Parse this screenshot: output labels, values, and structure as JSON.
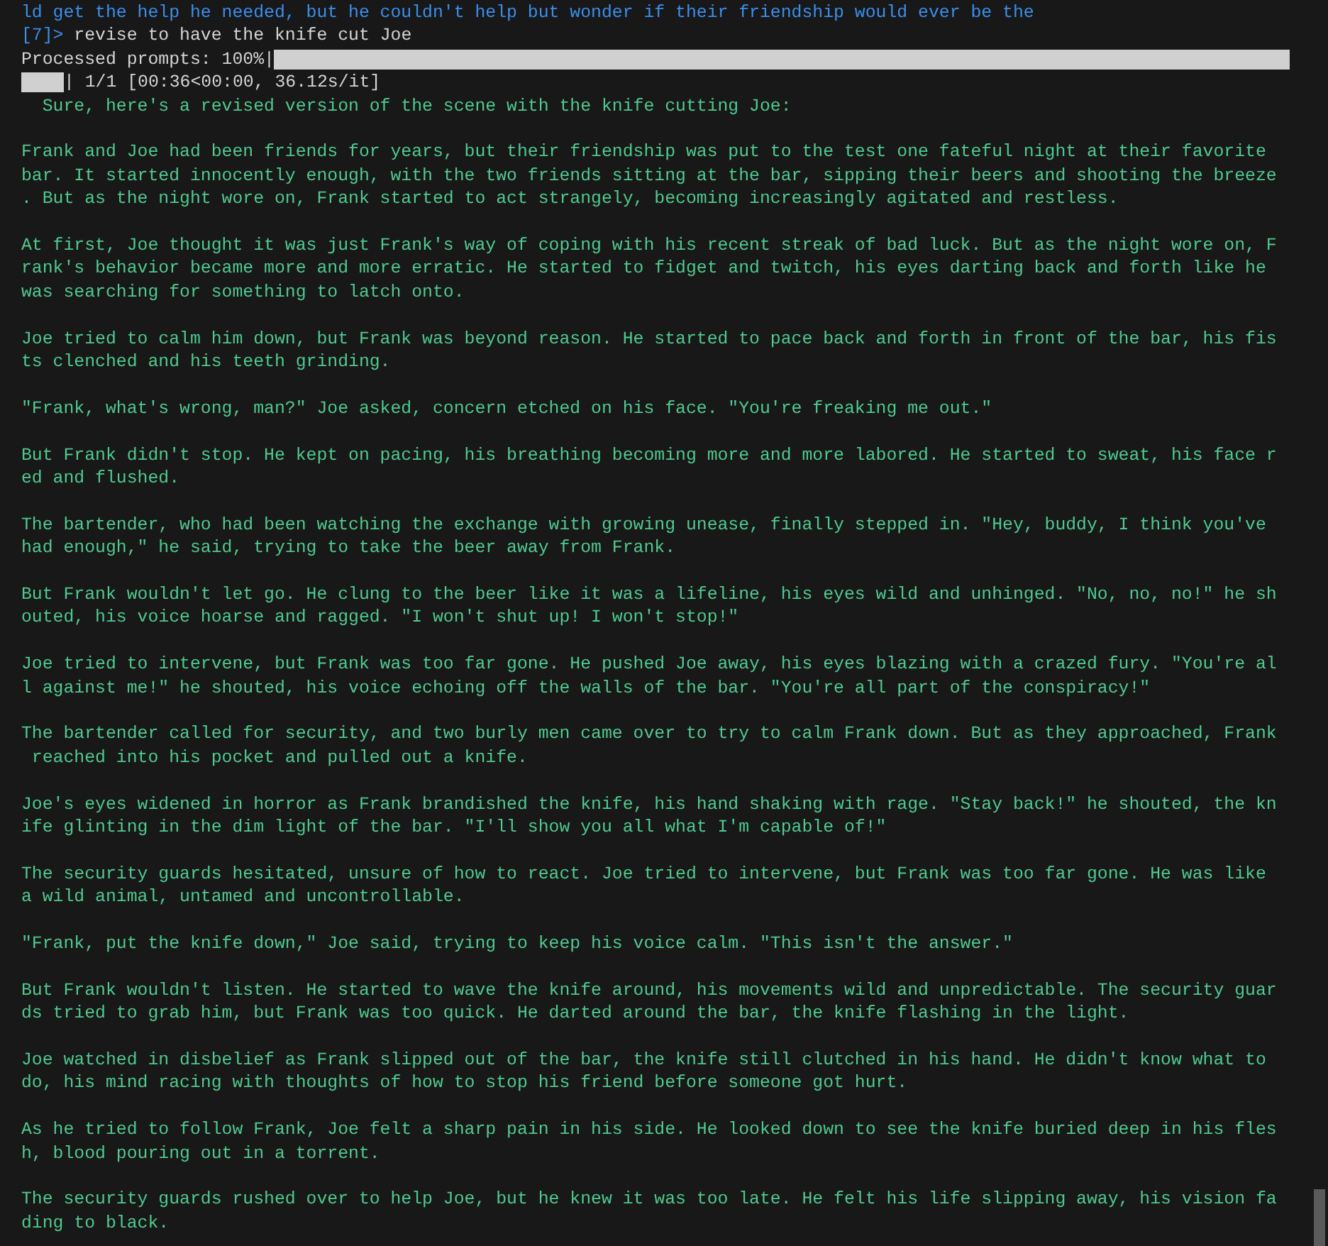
{
  "previous_output": "ld get the help he needed, but he couldn't help but wonder if their friendship would ever be the",
  "prompt": {
    "marker": "[7]>",
    "text": " revise to have the knife cut Joe"
  },
  "progress": {
    "label": "Processed prompts: 100%|",
    "level": 1,
    "stats": "| 1/1 [00:36<00:00, 36.12s/it]"
  },
  "response_intro": "  Sure, here's a revised version of the scene with the knife cutting Joe:",
  "paragraphs": [
    [
      "Frank and Joe had been friends for years, but their friendship was put to the test one fateful night at their favorite",
      "bar. It started innocently enough, with the two friends sitting at the bar, sipping their beers and shooting the breeze",
      ". But as the night wore on, Frank started to act strangely, becoming increasingly agitated and restless."
    ],
    [
      "At first, Joe thought it was just Frank's way of coping with his recent streak of bad luck. But as the night wore on, F",
      "rank's behavior became more and more erratic. He started to fidget and twitch, his eyes darting back and forth like he",
      "was searching for something to latch onto."
    ],
    [
      "Joe tried to calm him down, but Frank was beyond reason. He started to pace back and forth in front of the bar, his fis",
      "ts clenched and his teeth grinding."
    ],
    [
      "\"Frank, what's wrong, man?\" Joe asked, concern etched on his face. \"You're freaking me out.\""
    ],
    [
      "But Frank didn't stop. He kept on pacing, his breathing becoming more and more labored. He started to sweat, his face r",
      "ed and flushed."
    ],
    [
      "The bartender, who had been watching the exchange with growing unease, finally stepped in. \"Hey, buddy, I think you've",
      "had enough,\" he said, trying to take the beer away from Frank."
    ],
    [
      "But Frank wouldn't let go. He clung to the beer like it was a lifeline, his eyes wild and unhinged. \"No, no, no!\" he sh",
      "outed, his voice hoarse and ragged. \"I won't shut up! I won't stop!\""
    ],
    [
      "Joe tried to intervene, but Frank was too far gone. He pushed Joe away, his eyes blazing with a crazed fury. \"You're al",
      "l against me!\" he shouted, his voice echoing off the walls of the bar. \"You're all part of the conspiracy!\""
    ],
    [
      "The bartender called for security, and two burly men came over to try to calm Frank down. But as they approached, Frank",
      " reached into his pocket and pulled out a knife."
    ],
    [
      "Joe's eyes widened in horror as Frank brandished the knife, his hand shaking with rage. \"Stay back!\" he shouted, the kn",
      "ife glinting in the dim light of the bar. \"I'll show you all what I'm capable of!\""
    ],
    [
      "The security guards hesitated, unsure of how to react. Joe tried to intervene, but Frank was too far gone. He was like",
      "a wild animal, untamed and uncontrollable."
    ],
    [
      "\"Frank, put the knife down,\" Joe said, trying to keep his voice calm. \"This isn't the answer.\""
    ],
    [
      "But Frank wouldn't listen. He started to wave the knife around, his movements wild and unpredictable. The security guar",
      "ds tried to grab him, but Frank was too quick. He darted around the bar, the knife flashing in the light."
    ],
    [
      "Joe watched in disbelief as Frank slipped out of the bar, the knife still clutched in his hand. He didn't know what to",
      "do, his mind racing with thoughts of how to stop his friend before someone got hurt."
    ],
    [
      "As he tried to follow Frank, Joe felt a sharp pain in his side. He looked down to see the knife buried deep in his fles",
      "h, blood pouring out in a torrent."
    ],
    [
      "The security guards rushed over to help Joe, but he knew it was too late. He felt his life slipping away, his vision fa",
      "ding to black."
    ]
  ]
}
